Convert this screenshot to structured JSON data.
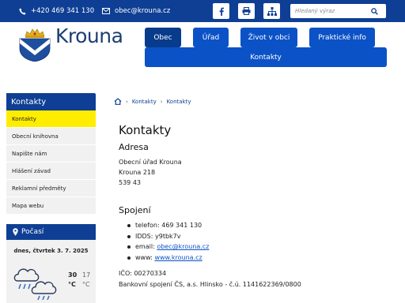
{
  "topbar": {
    "phone": "+420 469 341 130",
    "email": "obec@krouna.cz",
    "search_placeholder": "Hledaný výraz"
  },
  "header": {
    "title": "Krouna",
    "nav": [
      "Obec",
      "Úřad",
      "Život v obci",
      "Praktické info",
      "Kontakty"
    ]
  },
  "sidebar": {
    "heading": "Kontakty",
    "items": [
      {
        "label": "Kontakty"
      },
      {
        "label": "Obecní knihovna"
      },
      {
        "label": "Napište nám"
      },
      {
        "label": "Hlášení závad"
      },
      {
        "label": "Reklamní předměty"
      },
      {
        "label": "Mapa webu"
      }
    ]
  },
  "weather": {
    "heading": "Počasí",
    "date": "dnes, čtvrtek 3. 7. 2025",
    "temp_high": "30",
    "temp_low": "17",
    "unit": "°C"
  },
  "breadcrumb": [
    "Kontakty",
    "Kontakty"
  ],
  "main": {
    "title": "Kontakty",
    "address_heading": "Adresa",
    "address_lines": [
      "Obecní úřad Krouna",
      "Krouna 218",
      "539 43"
    ],
    "contact_heading": "Spojení",
    "phone_label": "telefon: 469 341 130",
    "idds_label": "IDDS: y9tbk7v",
    "email_prefix": "email: ",
    "email": "obec@krouna.cz",
    "www_prefix": "www: ",
    "www": "www.krouna.cz",
    "ico": "IČO: 00270334",
    "bank": "Bankovní spojení ČS, a.s. Hlinsko - č.ú. 1141622369/0800"
  },
  "colors": {
    "primary": "#0e3f94",
    "nav_button": "#0c52c7",
    "accent_yellow": "#ffed00"
  }
}
